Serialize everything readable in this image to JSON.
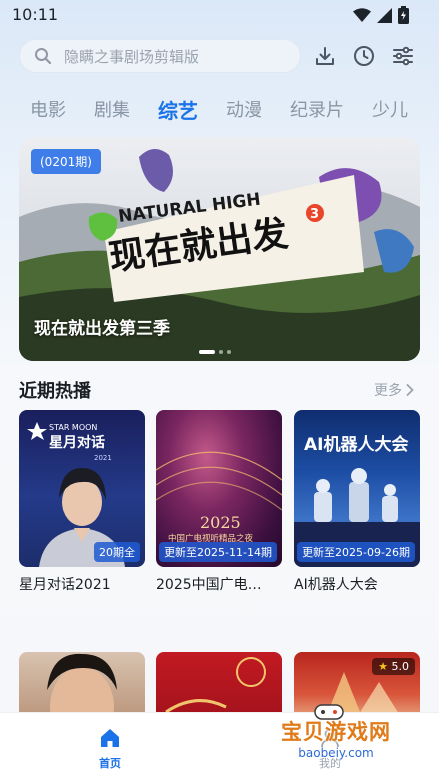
{
  "status_bar": {
    "time": "10:11"
  },
  "search": {
    "placeholder": "隐瞒之事剧场剪辑版"
  },
  "top_icons": [
    "download-icon",
    "history-icon",
    "filter-icon"
  ],
  "tabs": [
    {
      "label": "电影",
      "active": false
    },
    {
      "label": "剧集",
      "active": false
    },
    {
      "label": "综艺",
      "active": true
    },
    {
      "label": "动漫",
      "active": false
    },
    {
      "label": "纪录片",
      "active": false
    },
    {
      "label": "少儿",
      "active": false
    }
  ],
  "banner": {
    "episode_tag": "(0201期)",
    "title": "现在就出发第三季",
    "artwork_text_en": "NATURAL HIGH",
    "artwork_text_cn": "现在就出发",
    "artwork_season": "3",
    "page_indicator": {
      "current": 1,
      "total": 3
    }
  },
  "section": {
    "title": "近期热播",
    "more_label": "更多"
  },
  "cards": [
    {
      "title": "星月对话2021",
      "badge": "20期全",
      "poster_text_en": "STAR MOON",
      "poster_text_cn": "星月对话",
      "poster_year": "2021"
    },
    {
      "title": "2025中国广电…",
      "badge": "更新至2025-11-14期",
      "poster_year": "2025",
      "poster_text_cn": "中国广电视听精品之夜"
    },
    {
      "title": "AI机器人大会",
      "badge": "更新至2025-09-26期",
      "poster_text_cn": "AI机器人大会"
    }
  ],
  "second_row": {
    "rating": "5.0"
  },
  "bottom_nav": {
    "home_label": "首页",
    "mine_label": "我的"
  },
  "watermark": {
    "line1": "宝贝游戏网",
    "line2": "baobeiy.com"
  },
  "colors": {
    "accent": "#1a73e8",
    "badge": "#1e5ad2"
  }
}
